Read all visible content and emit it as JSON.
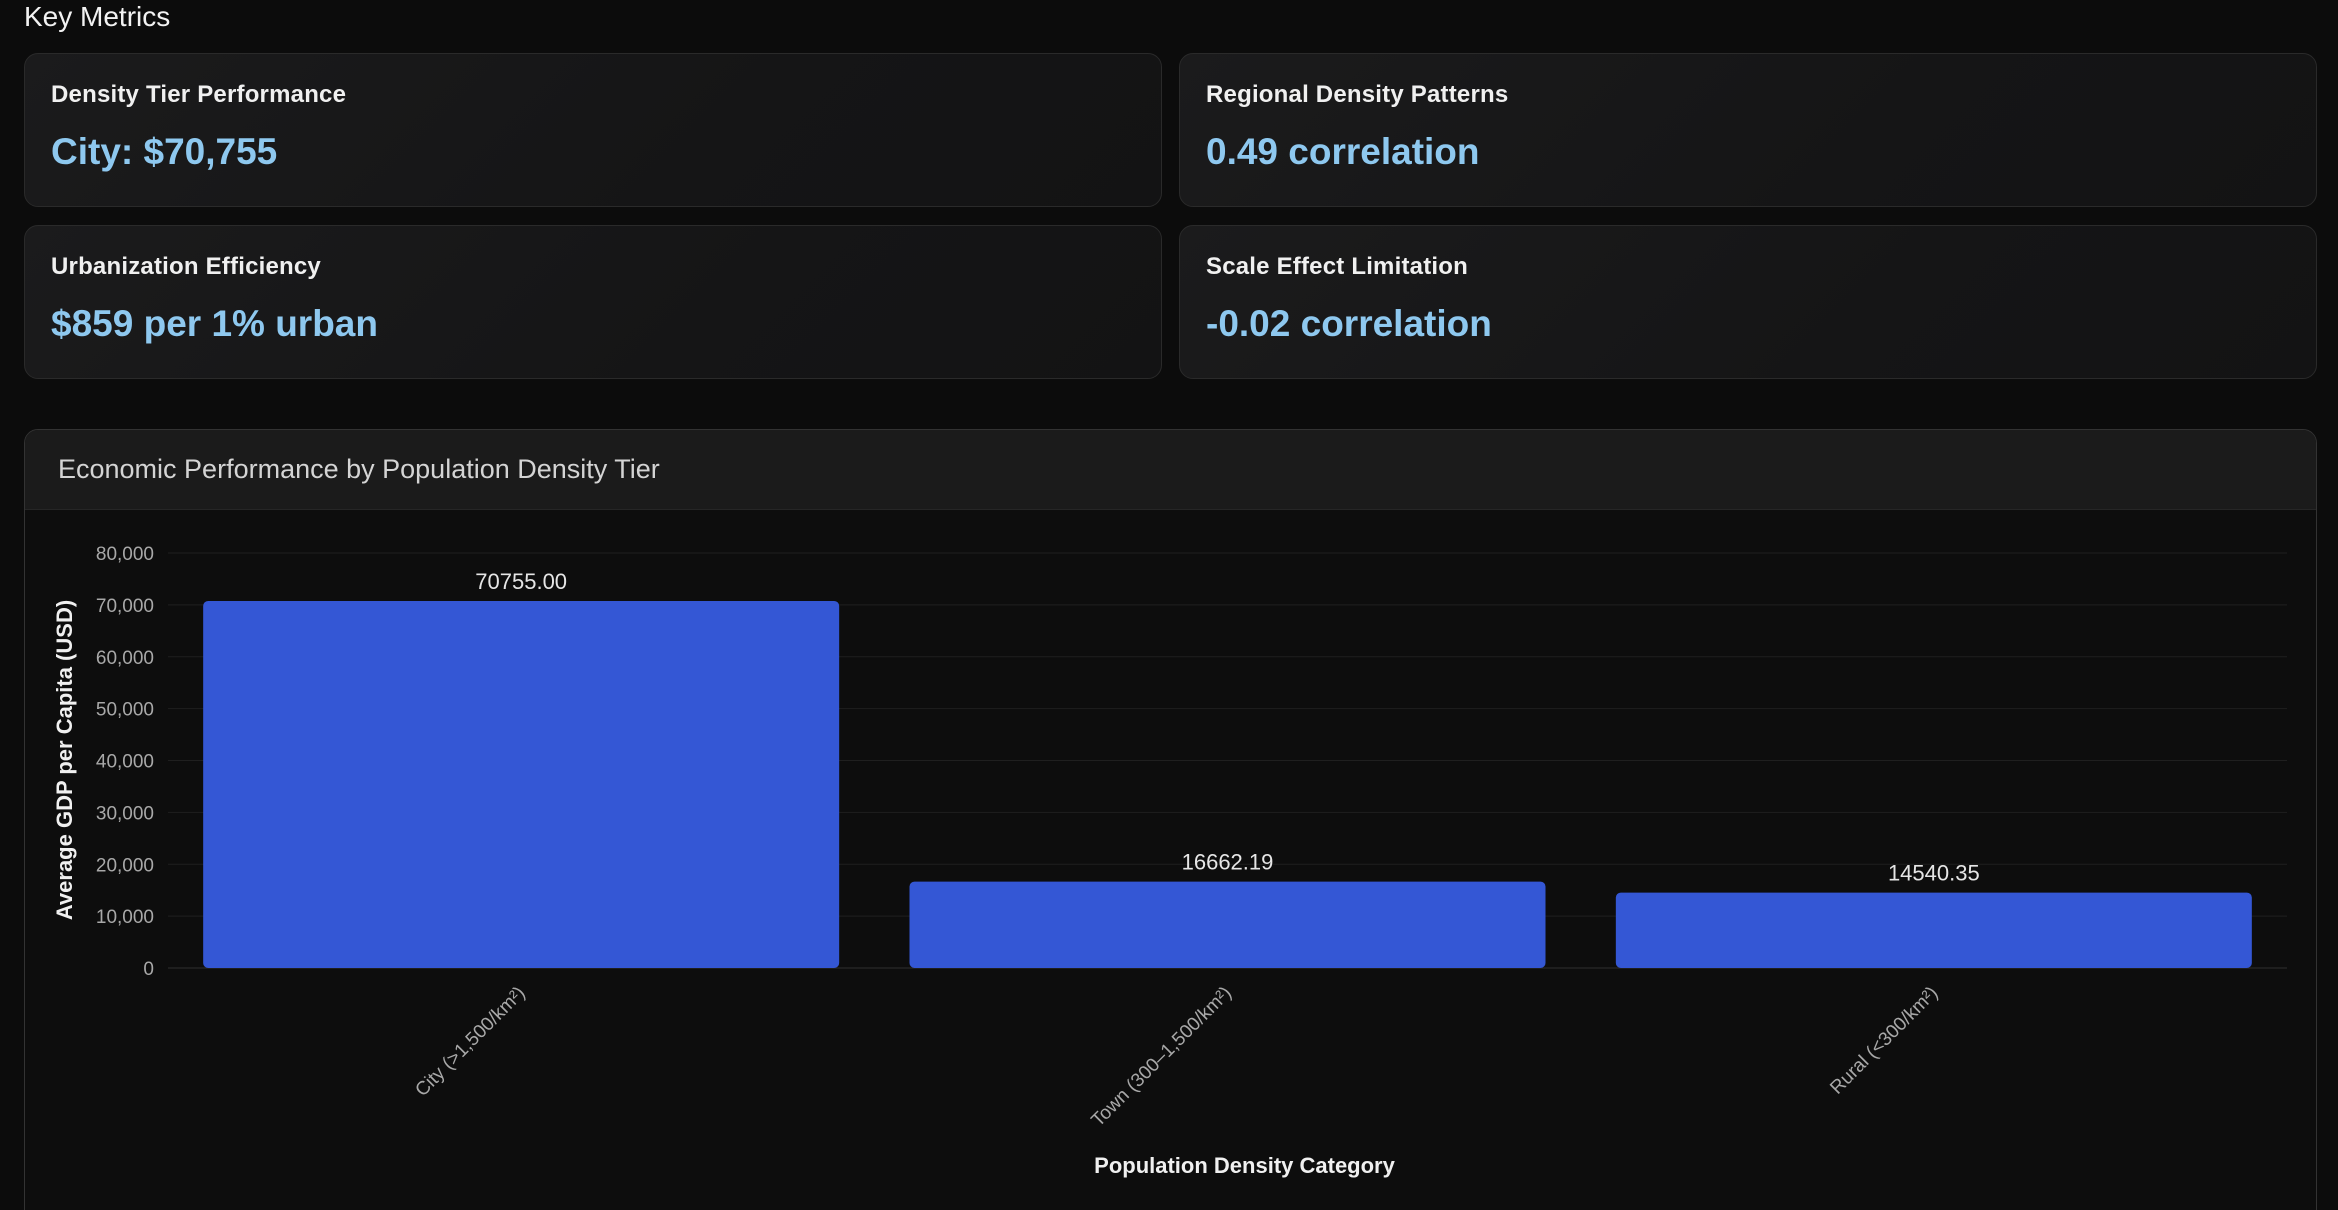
{
  "section": {
    "title": "Key Metrics"
  },
  "metrics": [
    {
      "label": "Density Tier Performance",
      "value": "City: $70,755"
    },
    {
      "label": "Regional Density Patterns",
      "value": "0.49 correlation"
    },
    {
      "label": "Urbanization Efficiency",
      "value": "$859 per 1% urban"
    },
    {
      "label": "Scale Effect Limitation",
      "value": "-0.02 correlation"
    }
  ],
  "chart": {
    "title": "Economic Performance by Population Density Tier"
  },
  "colors": {
    "bar": "#3457d5",
    "metric_value": "#8ec8ef",
    "background": "#0c0c0c"
  },
  "chart_data": {
    "type": "bar",
    "title": "Economic Performance by Population Density Tier",
    "categories": [
      "City (>1,500/km²)",
      "Town (300–1,500/km²)",
      "Rural (<300/km²)"
    ],
    "values": [
      70755.0,
      16662.19,
      14540.35
    ],
    "data_labels": [
      "70755.00",
      "16662.19",
      "14540.35"
    ],
    "xlabel": "Population Density Category",
    "ylabel": "Average GDP per Capita (USD)",
    "ylim": [
      0,
      80000
    ],
    "yticks": [
      0,
      10000,
      20000,
      30000,
      40000,
      50000,
      60000,
      70000,
      80000
    ],
    "ytick_labels": [
      "0",
      "10,000",
      "20,000",
      "30,000",
      "40,000",
      "50,000",
      "60,000",
      "70,000",
      "80,000"
    ],
    "grid": true,
    "legend": "none"
  }
}
